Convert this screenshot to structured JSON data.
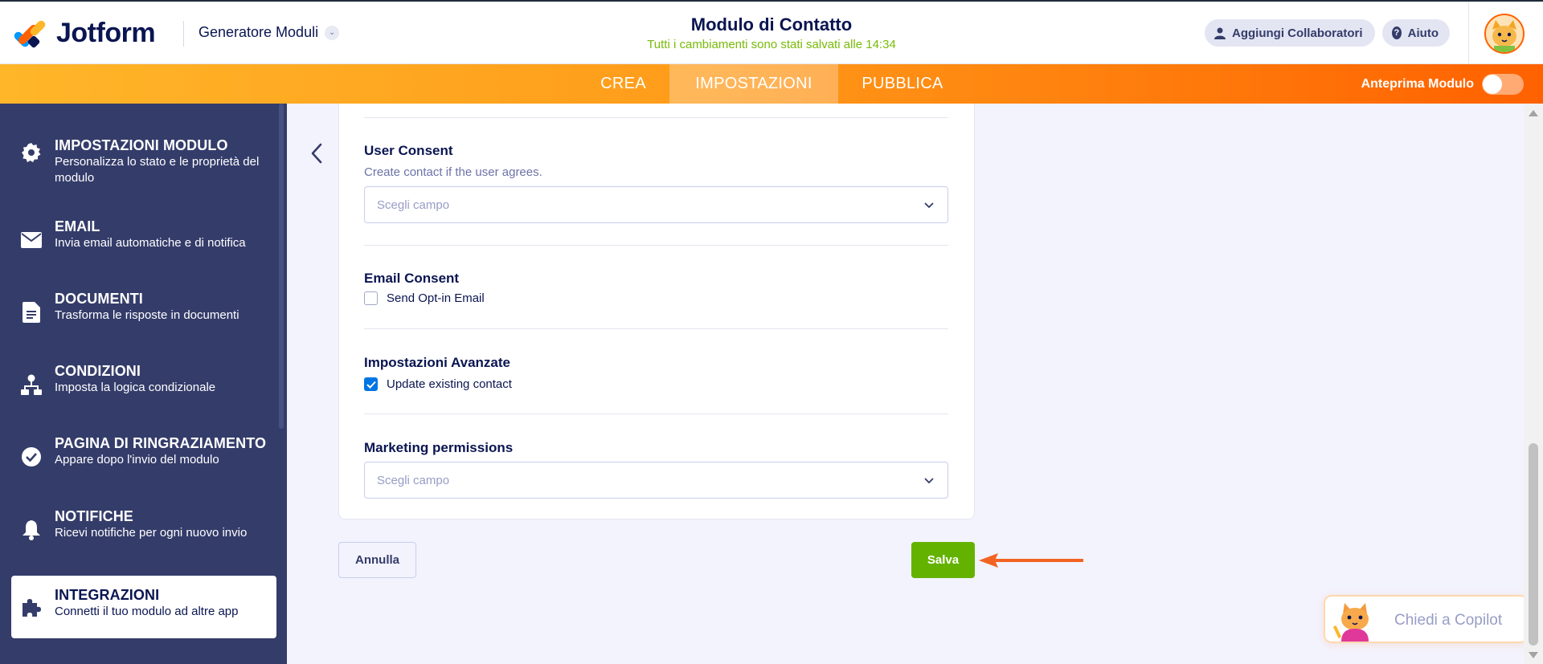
{
  "header": {
    "logo_text": "Jotform",
    "builder_label": "Generatore Moduli",
    "form_title": "Modulo di Contatto",
    "saved_status": "Tutti i cambiamenti sono stati salvati alle 14:34",
    "collaborators_label": "Aggiungi Collaboratori",
    "help_label": "Aiuto"
  },
  "nav": {
    "tabs": [
      {
        "label": "CREA",
        "active": false
      },
      {
        "label": "IMPOSTAZIONI",
        "active": true
      },
      {
        "label": "PUBBLICA",
        "active": false
      }
    ],
    "preview_label": "Anteprima Modulo",
    "preview_on": false
  },
  "sidebar": {
    "items": [
      {
        "title": "IMPOSTAZIONI MODULO",
        "desc": "Personalizza lo stato e le proprietà del modulo",
        "icon": "gear-icon",
        "active": false
      },
      {
        "title": "EMAIL",
        "desc": "Invia email automatiche e di notifica",
        "icon": "envelope-icon",
        "active": false
      },
      {
        "title": "DOCUMENTI",
        "desc": "Trasforma le risposte in documenti",
        "icon": "document-icon",
        "active": false
      },
      {
        "title": "CONDIZIONI",
        "desc": "Imposta la logica condizionale",
        "icon": "hierarchy-icon",
        "active": false
      },
      {
        "title": "PAGINA DI RINGRAZIAMENTO",
        "desc": "Appare dopo l'invio del modulo",
        "icon": "check-circle-icon",
        "active": false
      },
      {
        "title": "NOTIFICHE",
        "desc": "Ricevi notifiche per ogni nuovo invio",
        "icon": "bell-icon",
        "active": false
      },
      {
        "title": "INTEGRAZIONI",
        "desc": "Connetti il tuo modulo ad altre app",
        "icon": "puzzle-icon",
        "active": true
      }
    ]
  },
  "settings": {
    "user_consent": {
      "label": "User Consent",
      "hint": "Create contact if the user agrees.",
      "placeholder": "Scegli campo"
    },
    "email_consent": {
      "label": "Email Consent",
      "checkbox_label": "Send Opt-in Email",
      "checked": false
    },
    "advanced": {
      "label": "Impostazioni Avanzate",
      "checkbox_label": "Update existing contact",
      "checked": true
    },
    "marketing": {
      "label": "Marketing permissions",
      "placeholder": "Scegli campo"
    }
  },
  "actions": {
    "cancel_label": "Annulla",
    "save_label": "Salva"
  },
  "copilot": {
    "label": "Chiedi a Copilot"
  },
  "colors": {
    "brand_orange": "#ff6100",
    "sidebar_bg": "#343c6a",
    "save_green": "#64b200",
    "checkbox_blue": "#0075e3"
  }
}
